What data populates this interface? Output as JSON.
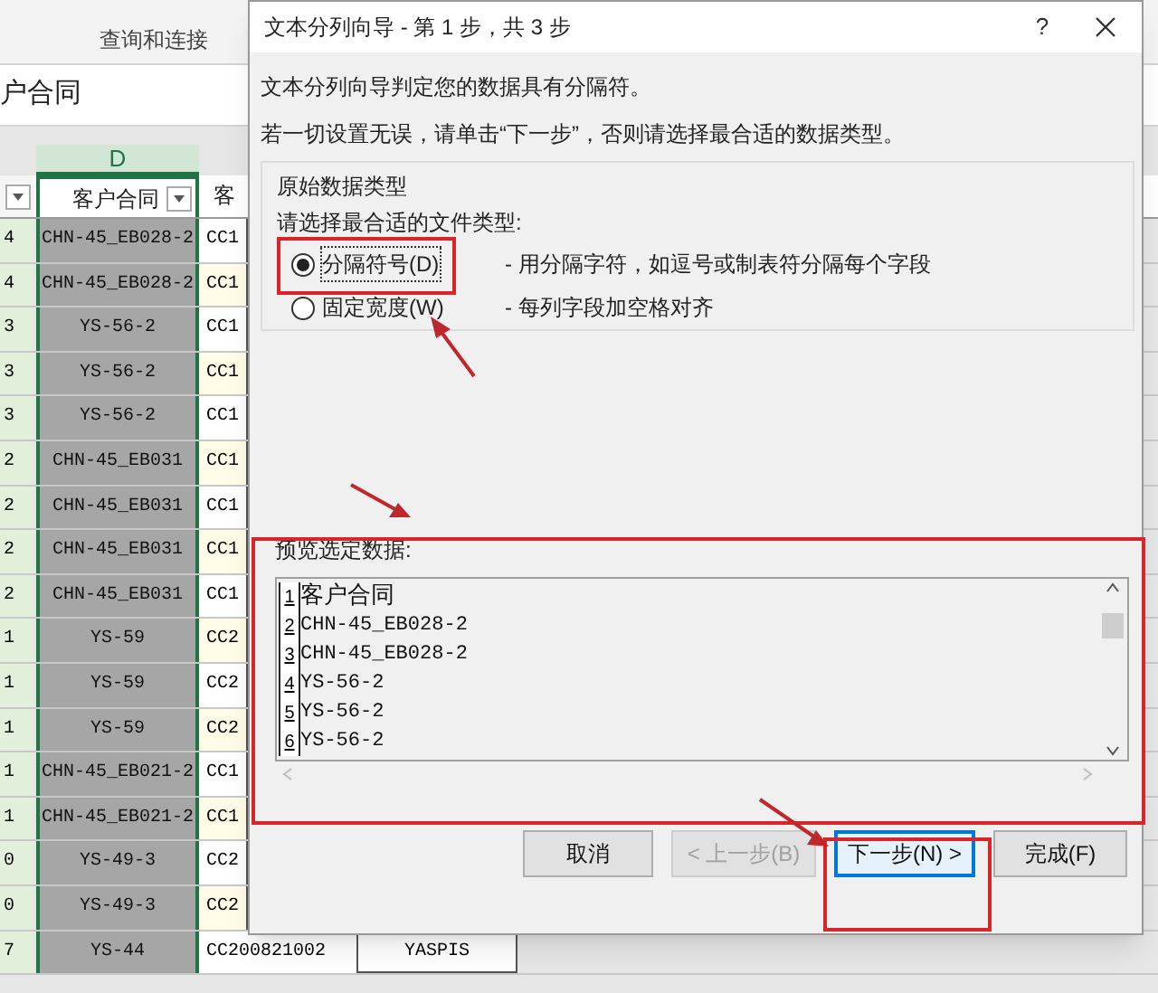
{
  "ribbon": {
    "group_label": "查询和连接"
  },
  "formula_bar": {
    "value": "户合同"
  },
  "sheet": {
    "column_header": "D",
    "header_cell": "客户合同",
    "header_partial": "客",
    "rows": [
      {
        "column_1": "4",
        "column_2": "CHN-45_EB028-2",
        "column_3": "CC1"
      },
      {
        "column_1": "4",
        "column_2": "CHN-45_EB028-2",
        "column_3": "CC1"
      },
      {
        "column_1": "3",
        "column_2": "YS-56-2",
        "column_3": "CC1"
      },
      {
        "column_1": "3",
        "column_2": "YS-56-2",
        "column_3": "CC1"
      },
      {
        "column_1": "3",
        "column_2": "YS-56-2",
        "column_3": "CC1"
      },
      {
        "column_1": "2",
        "column_2": "CHN-45_EB031",
        "column_3": "CC1"
      },
      {
        "column_1": "2",
        "column_2": "CHN-45_EB031",
        "column_3": "CC1"
      },
      {
        "column_1": "2",
        "column_2": "CHN-45_EB031",
        "column_3": "CC1"
      },
      {
        "column_1": "2",
        "column_2": "CHN-45_EB031",
        "column_3": "CC1"
      },
      {
        "column_1": "1",
        "column_2": "YS-59",
        "column_3": "CC2"
      },
      {
        "column_1": "1",
        "column_2": "YS-59",
        "column_3": "CC2"
      },
      {
        "column_1": "1",
        "column_2": "YS-59",
        "column_3": "CC2"
      },
      {
        "column_1": "1",
        "column_2": "CHN-45_EB021-2",
        "column_3": "CC1"
      },
      {
        "column_1": "1",
        "column_2": "CHN-45_EB021-2",
        "column_3": "CC1"
      },
      {
        "column_1": "0",
        "column_2": "YS-49-3",
        "column_3": "CC2"
      },
      {
        "column_1": "0",
        "column_2": "YS-49-3",
        "column_3": "CC2"
      },
      {
        "column_1": "7",
        "column_2": "YS-44",
        "column_3": "CC200821002",
        "column_4": "YASPIS"
      }
    ]
  },
  "dialog": {
    "title": "文本分列向导 - 第 1 步，共 3 步",
    "help": "?",
    "intro": "文本分列向导判定您的数据具有分隔符。",
    "hint": "若一切设置无误，请单击“下一步”，否则请选择最合适的数据类型。",
    "group": {
      "title": "原始数据类型",
      "prompt": "请选择最合适的文件类型:",
      "options": [
        {
          "label": "分隔符号(D)",
          "description": "- 用分隔字符，如逗号或制表符分隔每个字段",
          "selected": true
        },
        {
          "label": "固定宽度(W)",
          "description": "- 每列字段加空格对齐",
          "selected": false
        }
      ]
    },
    "preview": {
      "label": "预览选定数据:",
      "lines": [
        {
          "number": "1",
          "text": "客户合同"
        },
        {
          "number": "2",
          "text": "CHN-45_EB028-2"
        },
        {
          "number": "3",
          "text": "CHN-45_EB028-2"
        },
        {
          "number": "4",
          "text": "YS-56-2"
        },
        {
          "number": "5",
          "text": "YS-56-2"
        },
        {
          "number": "6",
          "text": "YS-56-2"
        }
      ]
    },
    "buttons": [
      {
        "label": "取消",
        "disabled": false,
        "default": false
      },
      {
        "label": "< 上一步(B)",
        "disabled": true,
        "default": false
      },
      {
        "label": "下一步(N) >",
        "disabled": false,
        "default": true
      },
      {
        "label": "完成(F)",
        "disabled": false,
        "default": false
      }
    ]
  }
}
